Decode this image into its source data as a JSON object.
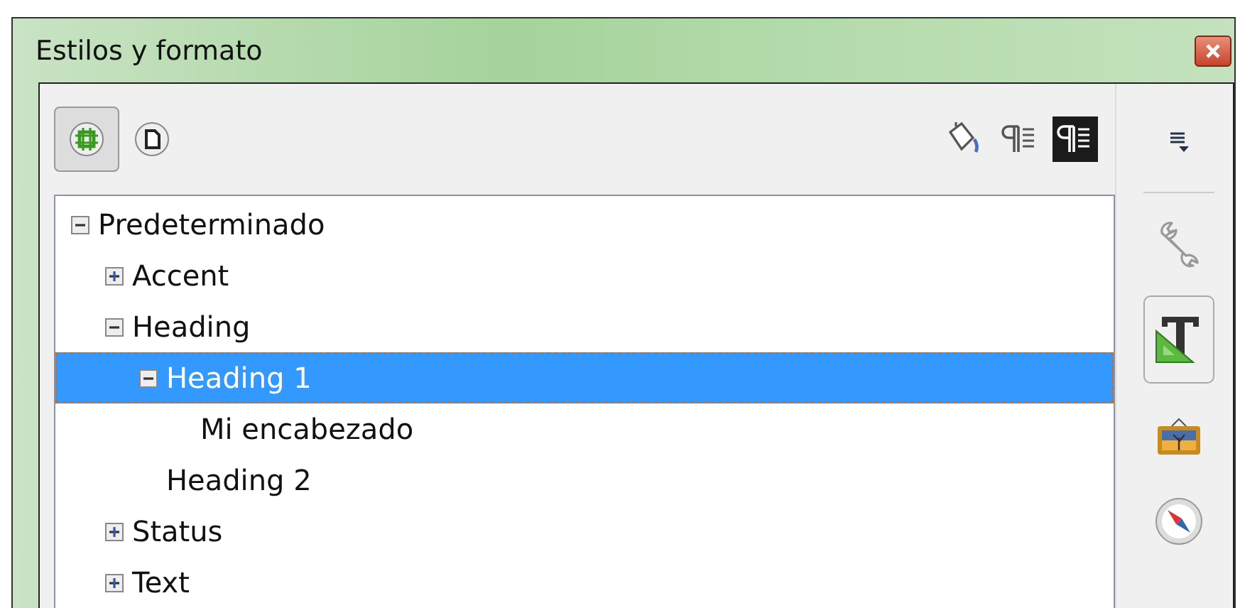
{
  "window": {
    "title": "Estilos y formato"
  },
  "toolbar_left": [
    {
      "kind": "frame",
      "selected": true
    },
    {
      "kind": "page",
      "selected": false
    }
  ],
  "toolbar_right": [
    {
      "kind": "fill",
      "selected": false
    },
    {
      "kind": "new",
      "selected": false
    },
    {
      "kind": "update",
      "selected": true
    }
  ],
  "tree": [
    {
      "label": "Predeterminado",
      "expanded": true,
      "selected": false,
      "children": [
        {
          "label": "Accent",
          "expanded": false,
          "selected": false
        },
        {
          "label": "Heading",
          "expanded": true,
          "selected": false,
          "children": [
            {
              "label": "Heading 1",
              "expanded": true,
              "selected": true,
              "children": [
                {
                  "label": "Mi encabezado",
                  "selected": false
                }
              ]
            },
            {
              "label": "Heading 2",
              "selected": false
            }
          ]
        },
        {
          "label": "Status",
          "expanded": false,
          "selected": false
        },
        {
          "label": "Text",
          "expanded": false,
          "selected": false
        }
      ]
    }
  ],
  "sidebar": [
    {
      "kind": "menu",
      "selected": false
    },
    {
      "kind": "properties",
      "selected": false
    },
    {
      "kind": "styles",
      "selected": true
    },
    {
      "kind": "gallery",
      "selected": false
    },
    {
      "kind": "navigator",
      "selected": false
    }
  ]
}
